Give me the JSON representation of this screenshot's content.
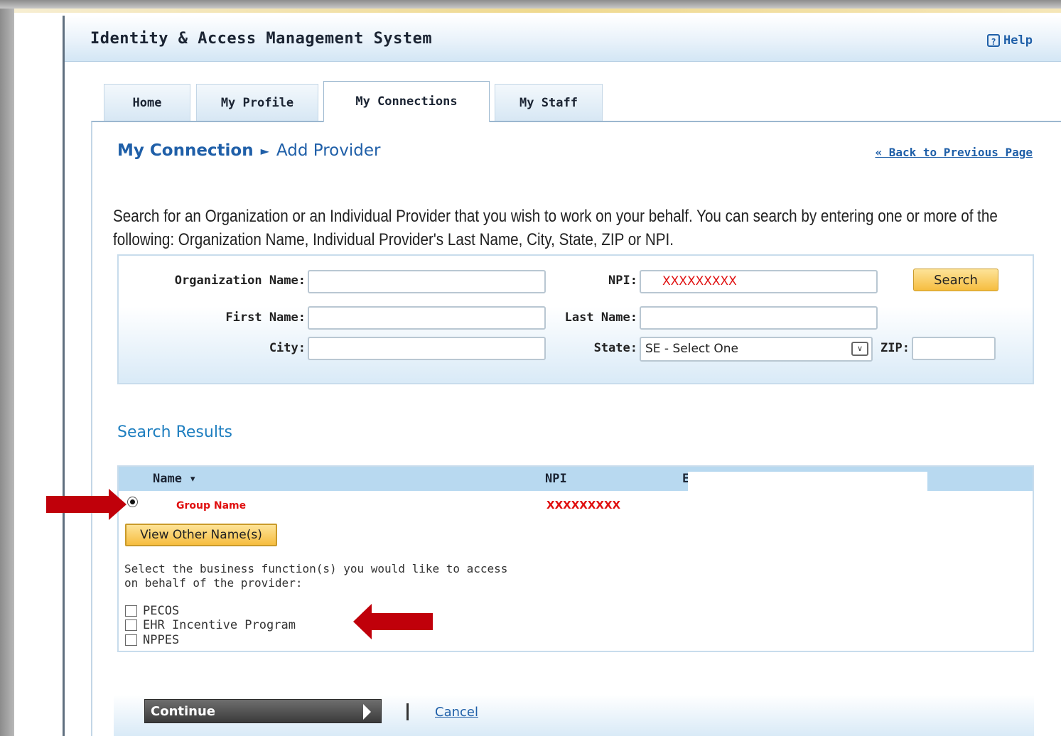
{
  "app": {
    "title": "Identity & Access Management System",
    "help_label": "Help"
  },
  "tabs": [
    {
      "label": "Home"
    },
    {
      "label": "My Profile"
    },
    {
      "label": "My Connections",
      "active": true
    },
    {
      "label": "My Staff"
    }
  ],
  "breadcrumb": {
    "parent": "My Connection",
    "separator": "►",
    "current": "Add Provider"
  },
  "back_link": "« Back to Previous Page",
  "intro_text": "Search for an Organization or an Individual Provider that you wish to work on your behalf. You can search by entering one or more of the following: Organization Name, Individual Provider's Last Name, City, State, ZIP or NPI.",
  "search_form": {
    "org_name_label": "Organization Name:",
    "org_name_value": "",
    "npi_label": "NPI:",
    "npi_value": "XXXXXXXXX",
    "first_name_label": "First Name:",
    "first_name_value": "",
    "last_name_label": "Last Name:",
    "last_name_value": "",
    "city_label": "City:",
    "city_value": "",
    "state_label": "State:",
    "state_value": "SE - Select One",
    "zip_label": "ZIP:",
    "zip_value": "",
    "search_button": "Search"
  },
  "results": {
    "title": "Search Results",
    "columns": {
      "name": "Name ▾",
      "npi": "NPI",
      "third": "E"
    },
    "row": {
      "name": "Group Name",
      "npi": "XXXXXXXXX",
      "selected": true
    },
    "view_names_button": "View Other Name(s)",
    "function_prompt_line1": "Select the business function(s) you would like to access",
    "function_prompt_line2": "on behalf of the provider:",
    "functions": [
      {
        "label": "PECOS",
        "checked": false
      },
      {
        "label": "EHR Incentive Program",
        "checked": false
      },
      {
        "label": "NPPES",
        "checked": false
      }
    ]
  },
  "footer": {
    "continue_button": "Continue",
    "cancel_link": "Cancel"
  },
  "colors": {
    "accent_blue": "#1f5fa8",
    "annotation_red": "#c0000a",
    "redacted_text": "#e01010",
    "button_gold": "#f6bd3f"
  }
}
